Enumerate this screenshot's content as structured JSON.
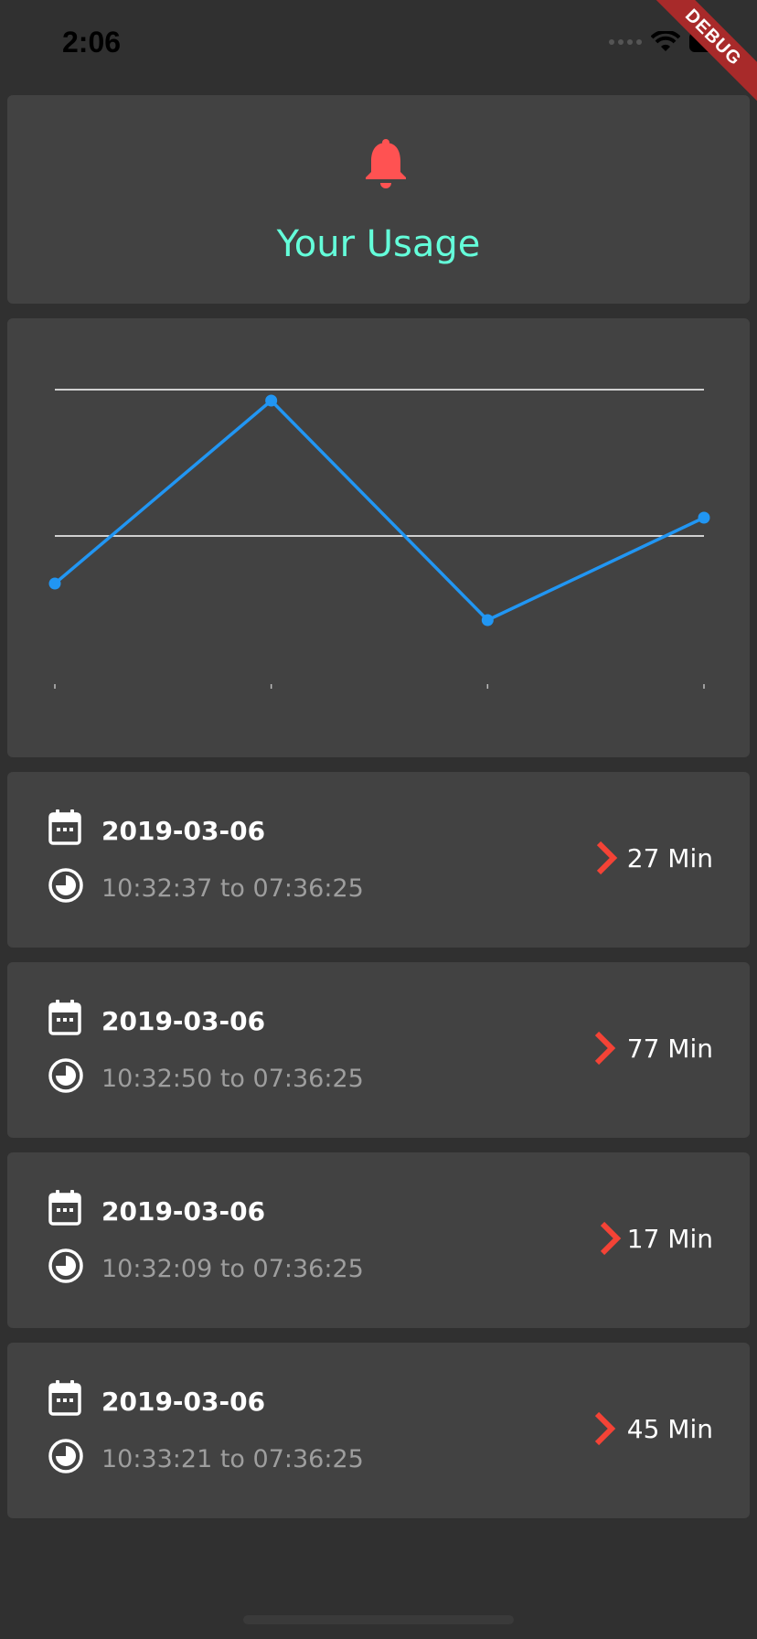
{
  "status_bar": {
    "time": "2:06",
    "debug_label": "DEBUG"
  },
  "header": {
    "icon": "bell-icon",
    "title": "Your Usage",
    "title_color": "#64FFDA",
    "icon_color": "#FF5252"
  },
  "chart_data": {
    "type": "line",
    "x": [
      0,
      1,
      2,
      3
    ],
    "series": [
      {
        "values": [
          27,
          77,
          17,
          45
        ],
        "color": "#2196F3"
      }
    ],
    "ylim": [
      0,
      80
    ],
    "grid_lines": [
      40,
      80
    ],
    "title": "",
    "xlabel": "",
    "ylabel": ""
  },
  "sessions": [
    {
      "date": "2019-03-06",
      "range": "10:32:37 to 07:36:25",
      "duration": "27 Min"
    },
    {
      "date": "2019-03-06",
      "range": "10:32:50 to 07:36:25",
      "duration": "77 Min"
    },
    {
      "date": "2019-03-06",
      "range": "10:32:09 to 07:36:25",
      "duration": "17 Min"
    },
    {
      "date": "2019-03-06",
      "range": "10:33:21 to 07:36:25",
      "duration": "45 Min"
    }
  ],
  "icons": {
    "calendar": "calendar-icon",
    "clock": "clock-icon",
    "chevron": "chevron-right-icon",
    "chevron_color": "#F44336"
  }
}
